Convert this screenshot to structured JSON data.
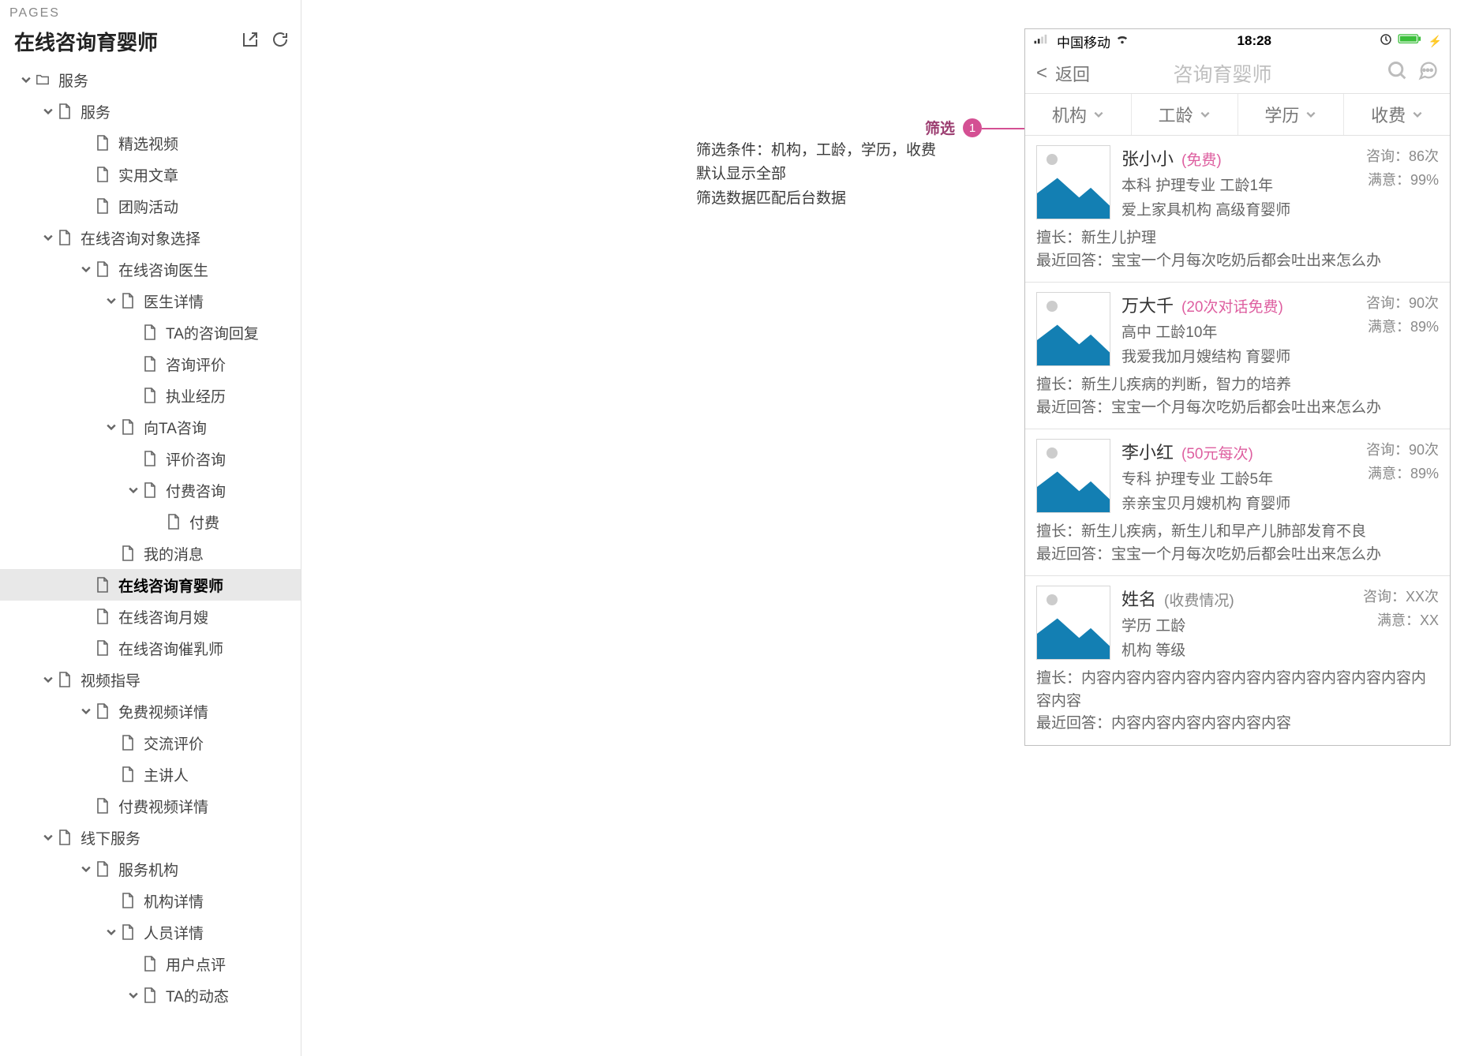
{
  "sidebar": {
    "header": "PAGES",
    "title": "在线咨询育婴师",
    "nodes": [
      {
        "indent": 0,
        "twisty": "down",
        "icon": "folder",
        "label": "服务"
      },
      {
        "indent": 1,
        "twisty": "down",
        "icon": "file",
        "label": "服务"
      },
      {
        "indent": 2,
        "twisty": "none",
        "icon": "file",
        "label": "精选视频"
      },
      {
        "indent": 2,
        "twisty": "none",
        "icon": "file",
        "label": "实用文章"
      },
      {
        "indent": 2,
        "twisty": "none",
        "icon": "file",
        "label": "团购活动"
      },
      {
        "indent": 1,
        "twisty": "down",
        "icon": "file",
        "label": "在线咨询对象选择"
      },
      {
        "indent": 2,
        "twisty": "down",
        "icon": "file",
        "label": "在线咨询医生"
      },
      {
        "indent": 3,
        "twisty": "down",
        "icon": "file",
        "label": "医生详情"
      },
      {
        "indent": 4,
        "twisty": "none",
        "icon": "file",
        "label": "TA的咨询回复"
      },
      {
        "indent": 4,
        "twisty": "none",
        "icon": "file",
        "label": "咨询评价"
      },
      {
        "indent": 4,
        "twisty": "none",
        "icon": "file",
        "label": "执业经历"
      },
      {
        "indent": 3,
        "twisty": "down",
        "icon": "file",
        "label": "向TA咨询"
      },
      {
        "indent": 4,
        "twisty": "none",
        "icon": "file",
        "label": "评价咨询"
      },
      {
        "indent": 4,
        "twisty": "down",
        "icon": "file",
        "label": "付费咨询"
      },
      {
        "indent": 5,
        "twisty": "none",
        "icon": "file",
        "label": "付费"
      },
      {
        "indent": 3,
        "twisty": "none",
        "icon": "file",
        "label": "我的消息"
      },
      {
        "indent": 2,
        "twisty": "none",
        "icon": "file",
        "label": "在线咨询育婴师",
        "selected": true
      },
      {
        "indent": 2,
        "twisty": "none",
        "icon": "file",
        "label": "在线咨询月嫂"
      },
      {
        "indent": 2,
        "twisty": "none",
        "icon": "file",
        "label": "在线咨询催乳师"
      },
      {
        "indent": 1,
        "twisty": "down",
        "icon": "file",
        "label": "视频指导"
      },
      {
        "indent": 2,
        "twisty": "down",
        "icon": "file",
        "label": "免费视频详情"
      },
      {
        "indent": 3,
        "twisty": "none",
        "icon": "file",
        "label": "交流评价"
      },
      {
        "indent": 3,
        "twisty": "none",
        "icon": "file",
        "label": "主讲人"
      },
      {
        "indent": 2,
        "twisty": "none",
        "icon": "file",
        "label": "付费视频详情"
      },
      {
        "indent": 1,
        "twisty": "down",
        "icon": "file",
        "label": "线下服务"
      },
      {
        "indent": 2,
        "twisty": "down",
        "icon": "file",
        "label": "服务机构"
      },
      {
        "indent": 3,
        "twisty": "none",
        "icon": "file",
        "label": "机构详情"
      },
      {
        "indent": 3,
        "twisty": "down",
        "icon": "file",
        "label": "人员详情"
      },
      {
        "indent": 4,
        "twisty": "none",
        "icon": "file",
        "label": "用户点评"
      },
      {
        "indent": 4,
        "twisty": "down",
        "icon": "file",
        "label": "TA的动态"
      }
    ]
  },
  "annotation": {
    "line1": "筛选条件：机构，工龄，学历，收费",
    "line2": "默认显示全部",
    "line3": "筛选数据匹配后台数据"
  },
  "callout": {
    "label": "筛选",
    "badge": "1"
  },
  "phone": {
    "status": {
      "carrier": "中国移动",
      "time": "18:28"
    },
    "nav": {
      "back": "返回",
      "title": "咨询育婴师"
    },
    "filters": [
      "机构",
      "工龄",
      "学历",
      "收费"
    ],
    "cards": [
      {
        "name": "张小小",
        "badge": "(免费)",
        "info1": "本科 护理专业 工龄1年",
        "info2": "爱上家具机构 高级育婴师",
        "consult": "咨询：86次",
        "satisfy": "满意：99%",
        "skill": "擅长：新生儿护理",
        "recent": "最近回答：宝宝一个月每次吃奶后都会吐出来怎么办"
      },
      {
        "name": "万大千",
        "badge": "(20次对话免费)",
        "info1": "高中  工龄10年",
        "info2": "我爱我加月嫂结构  育婴师",
        "consult": "咨询：90次",
        "satisfy": "满意：89%",
        "skill": "擅长：新生儿疾病的判断，智力的培养",
        "recent": "最近回答：宝宝一个月每次吃奶后都会吐出来怎么办"
      },
      {
        "name": "李小红",
        "badge": "(50元每次)",
        "info1": "专科 护理专业  工龄5年",
        "info2": "亲亲宝贝月嫂机构  育婴师",
        "consult": "咨询：90次",
        "satisfy": "满意：89%",
        "skill": "擅长：新生儿疾病，新生儿和早产儿肺部发育不良",
        "recent": "最近回答：宝宝一个月每次吃奶后都会吐出来怎么办"
      },
      {
        "name": "姓名",
        "badge": "(收费情况)",
        "badgeColor": "#888",
        "info1": "学历 工龄",
        "info2": "机构 等级",
        "consult": "咨询：XX次",
        "satisfy": "满意：XX",
        "skill": "擅长：内容内容内容内容内容内容内容内容内容内容内容内容内容",
        "recent": "最近回答：内容内容内容内容内容内容"
      }
    ]
  }
}
